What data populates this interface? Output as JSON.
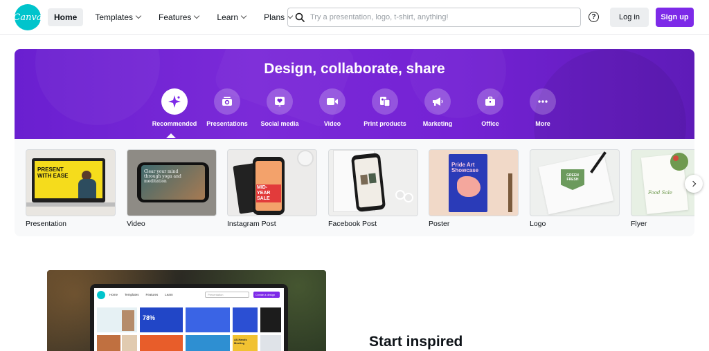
{
  "header": {
    "logo_text": "Canva",
    "nav": [
      {
        "label": "Home",
        "active": true,
        "dropdown": false
      },
      {
        "label": "Templates",
        "active": false,
        "dropdown": true
      },
      {
        "label": "Features",
        "active": false,
        "dropdown": true
      },
      {
        "label": "Learn",
        "active": false,
        "dropdown": true
      },
      {
        "label": "Plans",
        "active": false,
        "dropdown": true
      }
    ],
    "search_placeholder": "Try a presentation, logo, t-shirt, anything!",
    "help_icon": "?",
    "login_label": "Log in",
    "signup_label": "Sign up"
  },
  "hero": {
    "title": "Design, collaborate, share",
    "categories": [
      {
        "label": "Recommended",
        "icon": "sparkle-icon",
        "active": true
      },
      {
        "label": "Presentations",
        "icon": "presentation-icon",
        "active": false
      },
      {
        "label": "Social media",
        "icon": "heart-icon",
        "active": false
      },
      {
        "label": "Video",
        "icon": "video-icon",
        "active": false
      },
      {
        "label": "Print products",
        "icon": "print-icon",
        "active": false
      },
      {
        "label": "Marketing",
        "icon": "megaphone-icon",
        "active": false
      },
      {
        "label": "Office",
        "icon": "briefcase-icon",
        "active": false
      },
      {
        "label": "More",
        "icon": "more-icon",
        "active": false
      }
    ]
  },
  "design_types": [
    {
      "label": "Presentation",
      "thumb_text": "PRESENT WITH EASE"
    },
    {
      "label": "Video",
      "thumb_text": "Clear your mind through yoga and meditation"
    },
    {
      "label": "Instagram Post",
      "thumb_text": "MID-YEAR SALE"
    },
    {
      "label": "Facebook Post",
      "thumb_text": ""
    },
    {
      "label": "Poster",
      "thumb_text": "Pride Art Showcase"
    },
    {
      "label": "Logo",
      "thumb_text": "GREEN FRESH"
    },
    {
      "label": "Flyer",
      "thumb_text": "Food Sale"
    }
  ],
  "promo": {
    "mini_nav": [
      "Home",
      "Templates",
      "Features",
      "Learn"
    ],
    "mini_search": "Presentation",
    "mini_button": "Create a design",
    "mini_stat": "78%",
    "mini_card_text": "All-Hands Meeting"
  },
  "section_title": "Start inspired",
  "colors": {
    "brand_teal": "#00c4cc",
    "brand_purple": "#7d2ae8",
    "hero_purple": "#7422d4"
  }
}
